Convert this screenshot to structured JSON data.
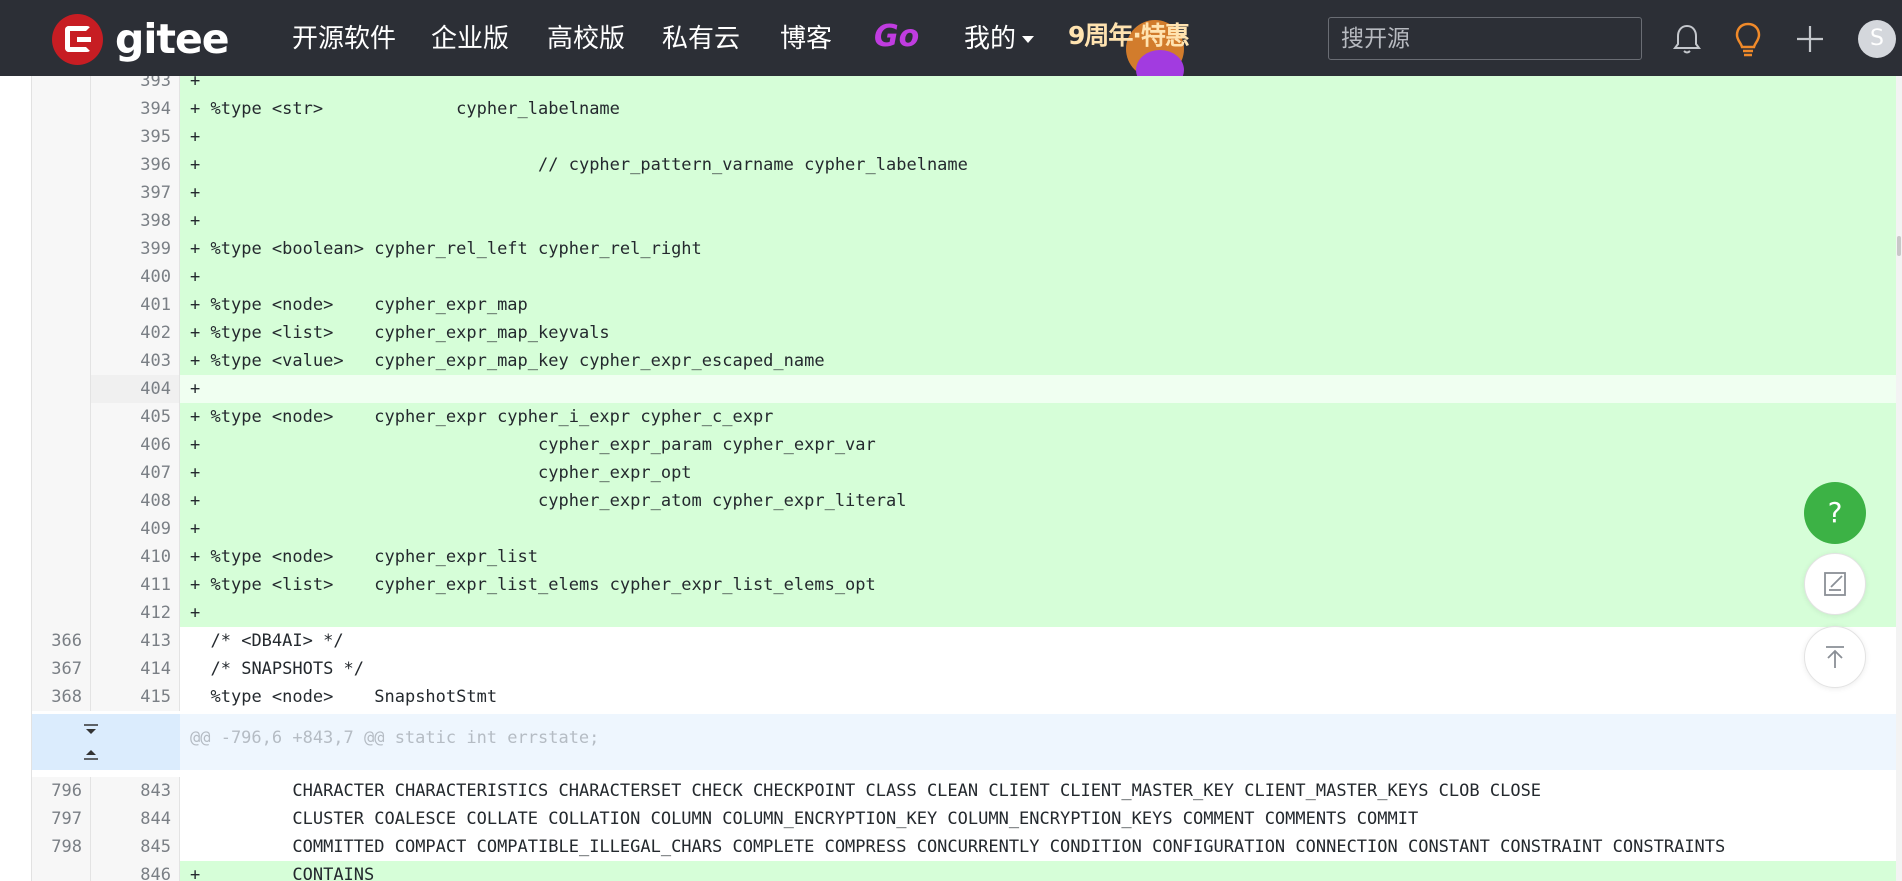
{
  "navbar": {
    "logo_text": "gitee",
    "items": [
      {
        "label": "开源软件"
      },
      {
        "label": "企业版"
      },
      {
        "label": "高校版"
      },
      {
        "label": "私有云"
      },
      {
        "label": "博客"
      }
    ],
    "go_label": "Go",
    "mine_label": "我的",
    "promo_text": "9周年·特惠",
    "search_placeholder": "搜开源",
    "avatar_letter": "S",
    "icons": [
      "bell-icon",
      "lightbulb-icon",
      "plus-icon"
    ]
  },
  "diff": {
    "lines": [
      {
        "type": "add",
        "old": "",
        "new": "393",
        "sign": "+",
        "text": ""
      },
      {
        "type": "add",
        "old": "",
        "new": "394",
        "sign": "+",
        "text": "%type <str>             cypher_labelname"
      },
      {
        "type": "add",
        "old": "",
        "new": "395",
        "sign": "+",
        "text": ""
      },
      {
        "type": "add",
        "old": "",
        "new": "396",
        "sign": "+",
        "text": "                                // cypher_pattern_varname cypher_labelname"
      },
      {
        "type": "add",
        "old": "",
        "new": "397",
        "sign": "+",
        "text": ""
      },
      {
        "type": "add",
        "old": "",
        "new": "398",
        "sign": "+",
        "text": ""
      },
      {
        "type": "add",
        "old": "",
        "new": "399",
        "sign": "+",
        "text": "%type <boolean> cypher_rel_left cypher_rel_right"
      },
      {
        "type": "add",
        "old": "",
        "new": "400",
        "sign": "+",
        "text": ""
      },
      {
        "type": "add",
        "old": "",
        "new": "401",
        "sign": "+",
        "text": "%type <node>    cypher_expr_map"
      },
      {
        "type": "add",
        "old": "",
        "new": "402",
        "sign": "+",
        "text": "%type <list>    cypher_expr_map_keyvals"
      },
      {
        "type": "add",
        "old": "",
        "new": "403",
        "sign": "+",
        "text": "%type <value>   cypher_expr_map_key cypher_expr_escaped_name"
      },
      {
        "type": "add-hl",
        "old": "",
        "new": "404",
        "sign": "+",
        "text": ""
      },
      {
        "type": "add",
        "old": "",
        "new": "405",
        "sign": "+",
        "text": "%type <node>    cypher_expr cypher_i_expr cypher_c_expr"
      },
      {
        "type": "add",
        "old": "",
        "new": "406",
        "sign": "+",
        "text": "                                cypher_expr_param cypher_expr_var"
      },
      {
        "type": "add",
        "old": "",
        "new": "407",
        "sign": "+",
        "text": "                                cypher_expr_opt"
      },
      {
        "type": "add",
        "old": "",
        "new": "408",
        "sign": "+",
        "text": "                                cypher_expr_atom cypher_expr_literal"
      },
      {
        "type": "add",
        "old": "",
        "new": "409",
        "sign": "+",
        "text": ""
      },
      {
        "type": "add",
        "old": "",
        "new": "410",
        "sign": "+",
        "text": "%type <node>    cypher_expr_list"
      },
      {
        "type": "add",
        "old": "",
        "new": "411",
        "sign": "+",
        "text": "%type <list>    cypher_expr_list_elems cypher_expr_list_elems_opt"
      },
      {
        "type": "add",
        "old": "",
        "new": "412",
        "sign": "+",
        "text": ""
      },
      {
        "type": "ctx",
        "old": "366",
        "new": "413",
        "sign": " ",
        "text": "/* <DB4AI> */"
      },
      {
        "type": "ctx",
        "old": "367",
        "new": "414",
        "sign": " ",
        "text": "/* SNAPSHOTS */"
      },
      {
        "type": "ctx",
        "old": "368",
        "new": "415",
        "sign": " ",
        "text": "%type <node>    SnapshotStmt"
      }
    ],
    "hunk_header": "@@ -796,6 +843,7 @@ static int errstate;",
    "lines_after": [
      {
        "type": "ctx",
        "old": "796",
        "new": "843",
        "sign": " ",
        "text": "        CHARACTER CHARACTERISTICS CHARACTERSET CHECK CHECKPOINT CLASS CLEAN CLIENT CLIENT_MASTER_KEY CLIENT_MASTER_KEYS CLOB CLOSE"
      },
      {
        "type": "ctx",
        "old": "797",
        "new": "844",
        "sign": " ",
        "text": "        CLUSTER COALESCE COLLATE COLLATION COLUMN COLUMN_ENCRYPTION_KEY COLUMN_ENCRYPTION_KEYS COMMENT COMMENTS COMMIT"
      },
      {
        "type": "ctx",
        "old": "798",
        "new": "845",
        "sign": " ",
        "text": "        COMMITTED COMPACT COMPATIBLE_ILLEGAL_CHARS COMPLETE COMPRESS CONCURRENTLY CONDITION CONFIGURATION CONNECTION CONSTANT CONSTRAINT CONSTRAINTS"
      },
      {
        "type": "add",
        "old": "",
        "new": "846",
        "sign": "+",
        "text": "        CONTAINS"
      }
    ]
  },
  "floating": {
    "help_label": "?",
    "icons": [
      "help-icon",
      "feedback-edit-icon",
      "back-to-top-icon"
    ]
  },
  "colors": {
    "navbar_bg": "#2c2f36",
    "added_line_bg": "#d6fed8",
    "hunk_bg": "#eef6fe",
    "help_button": "#3cb245",
    "brand_red": "#c71d23"
  }
}
